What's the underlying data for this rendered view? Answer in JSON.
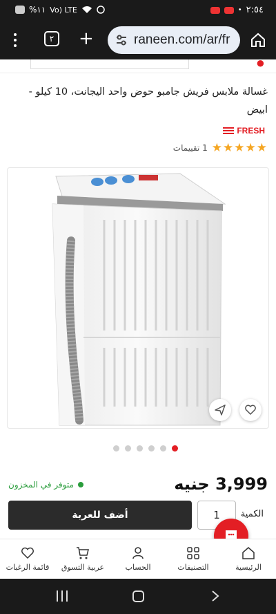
{
  "status_bar": {
    "time": "٢:٥٤",
    "battery": "%١١",
    "network": "Vo) LTE"
  },
  "browser": {
    "url": "raneen.com/ar/fr",
    "tab_count": "٢"
  },
  "product": {
    "title": "غسالة ملابس فريش جامبو حوض واحد اليجانت، 10 كيلو - ابيض",
    "brand": "FRESH",
    "stars": "★★★★★",
    "rating_count": "1 تقييمات",
    "price": "3,999 جنيه",
    "stock": "متوفر في المخزون",
    "image_count": 6,
    "active_image": 1
  },
  "cart": {
    "qty_label": "الكمية",
    "qty": "1",
    "add_label": "أضف للعربة"
  },
  "bottom_nav": {
    "items": [
      {
        "label": "الرئيسية",
        "icon": "home-icon"
      },
      {
        "label": "التصنيفات",
        "icon": "grid-icon"
      },
      {
        "label": "الحساب",
        "icon": "user-icon"
      },
      {
        "label": "عربية التسوق",
        "icon": "cart-icon"
      },
      {
        "label": "قائمة الرغبات",
        "icon": "heart-icon"
      }
    ]
  },
  "colors": {
    "accent": "#e31e24",
    "stock_green": "#2a9d3c",
    "star": "#f5a623",
    "dark": "#1a1a1a"
  }
}
